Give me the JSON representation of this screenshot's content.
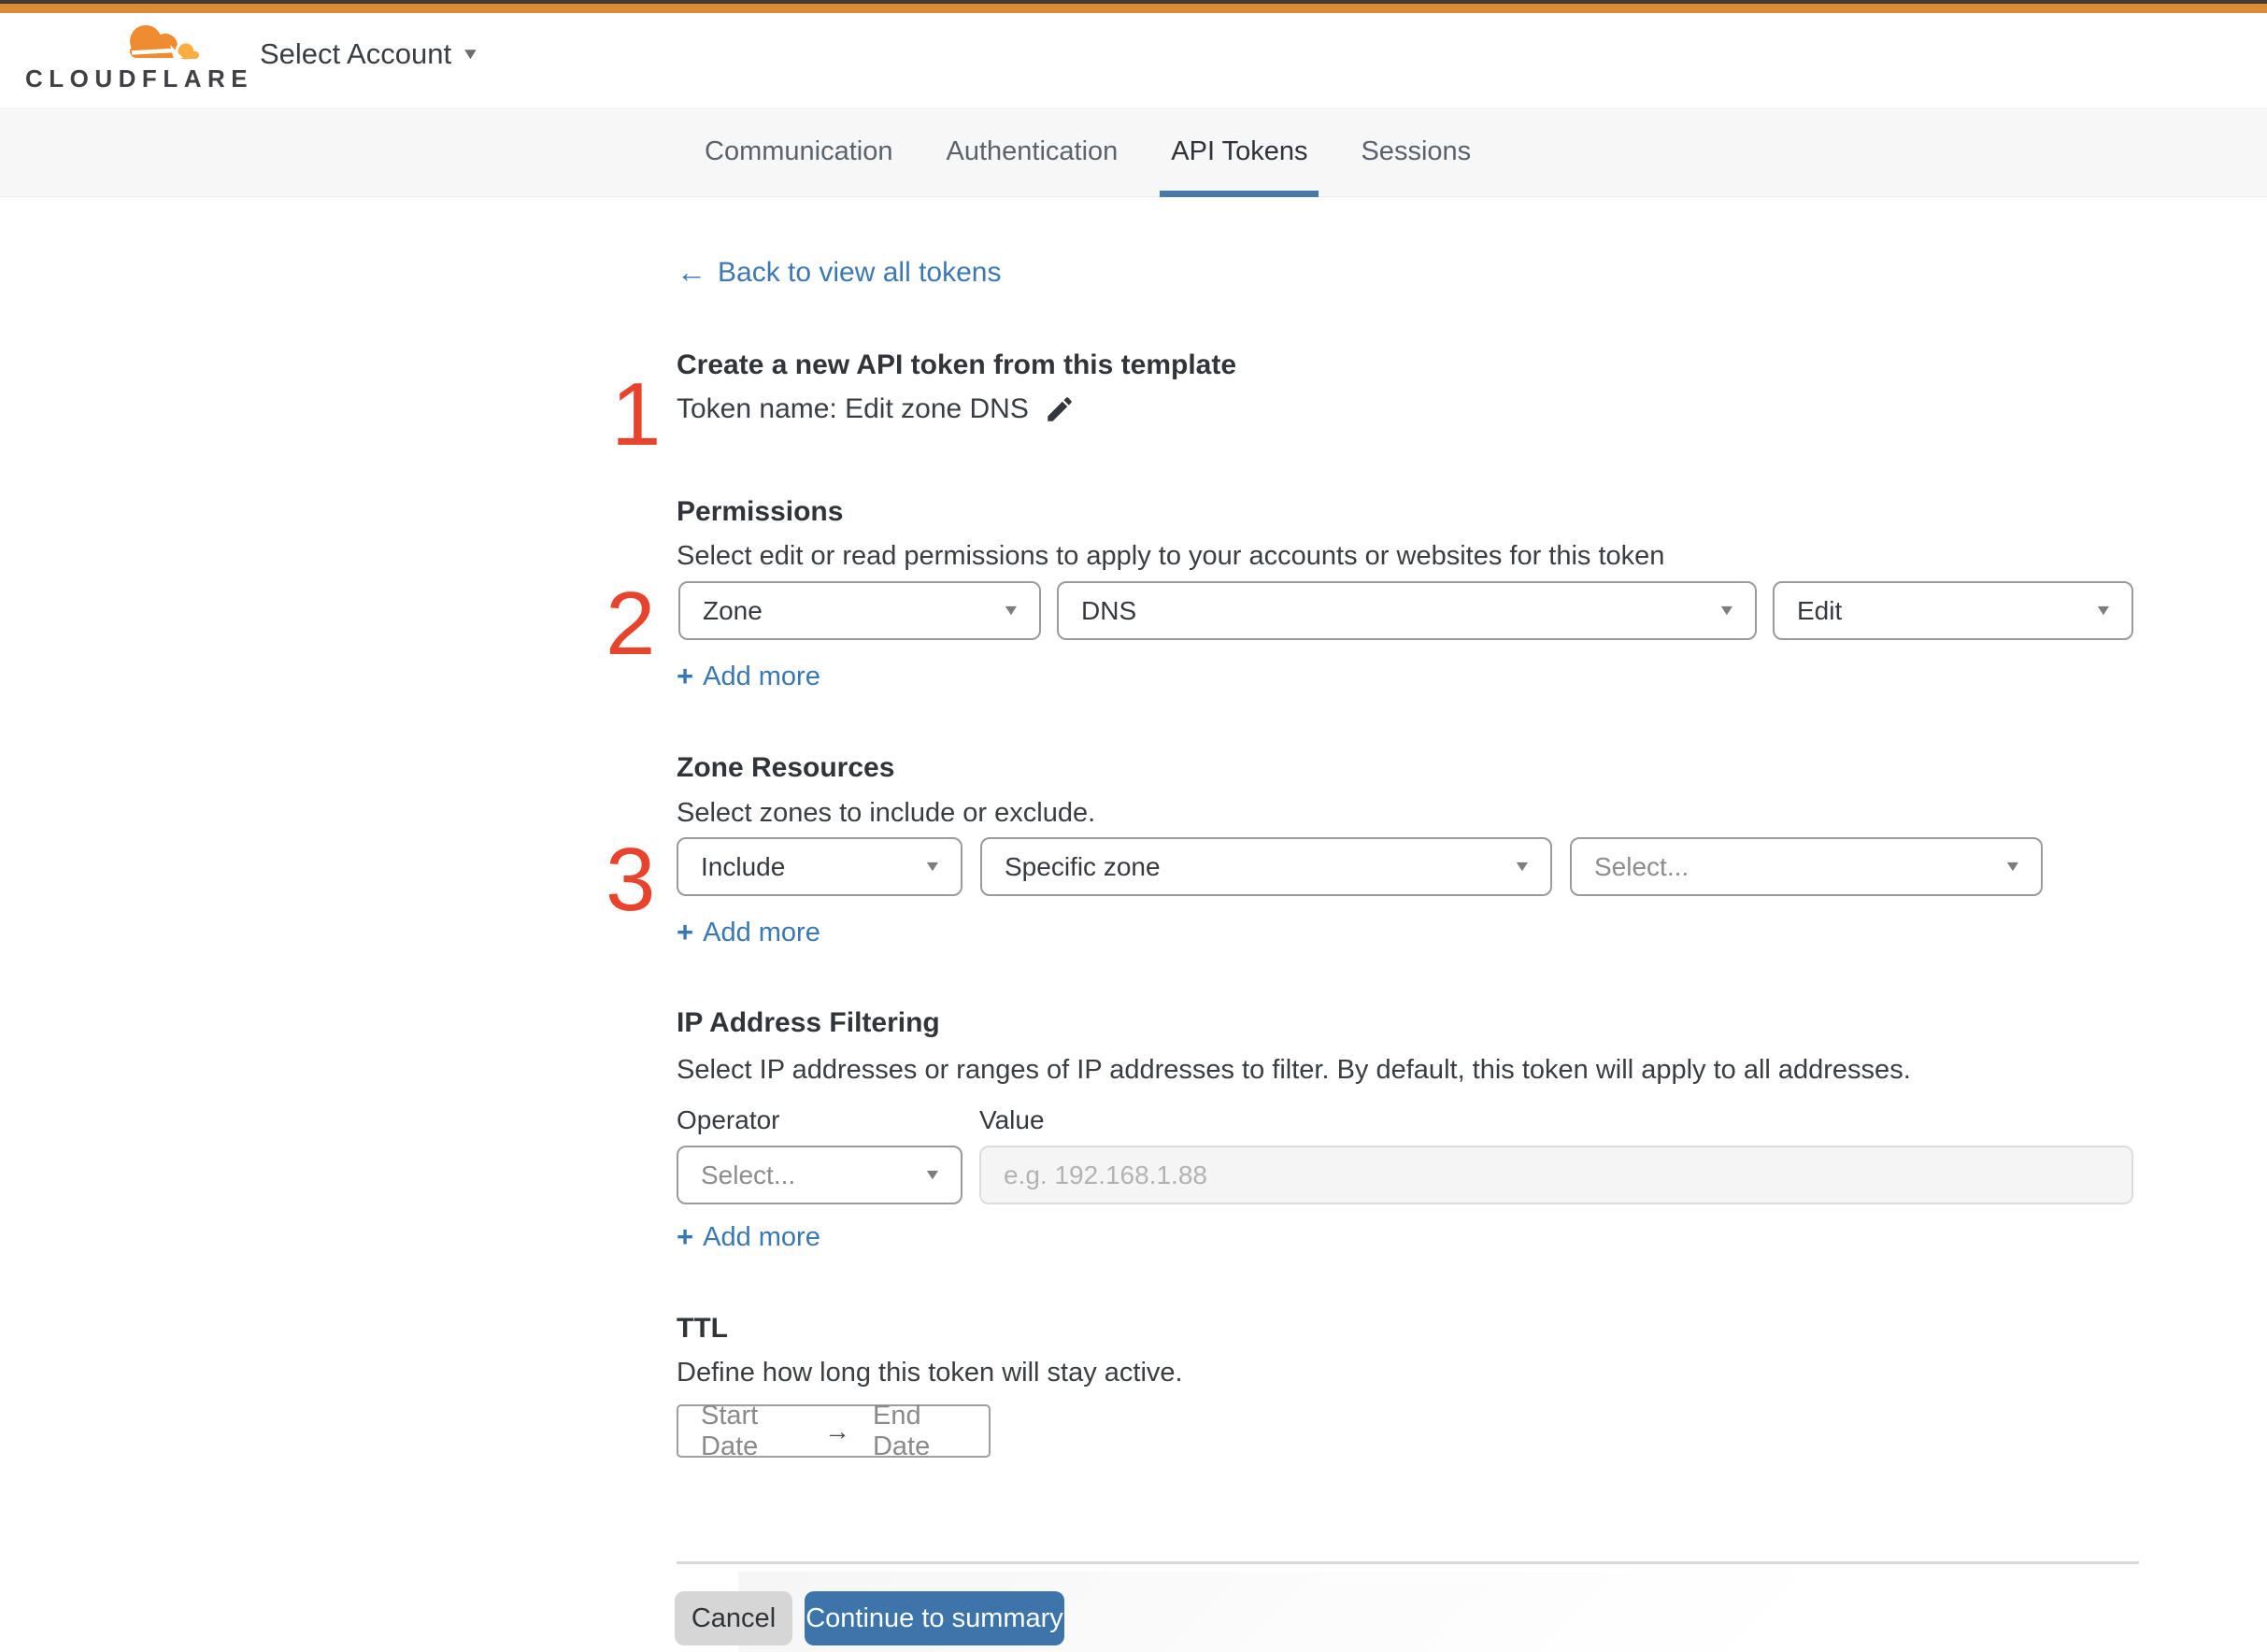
{
  "header": {
    "brand": "CLOUDFLARE",
    "account_selector": {
      "label": "Select Account",
      "caret": "▼"
    }
  },
  "tabs": [
    {
      "label": "Communication",
      "active": false
    },
    {
      "label": "Authentication",
      "active": false
    },
    {
      "label": "API Tokens",
      "active": true
    },
    {
      "label": "Sessions",
      "active": false
    }
  ],
  "back_link": {
    "arrow": "←",
    "label": "Back to view all tokens"
  },
  "steps": {
    "one": "1",
    "two": "2",
    "three": "3"
  },
  "create": {
    "title": "Create a new API token from this template",
    "token_name_label": "Token name: Edit zone DNS"
  },
  "permissions": {
    "title": "Permissions",
    "description": "Select edit or read permissions to apply to your accounts or websites for this token",
    "selects": [
      {
        "value": "Zone"
      },
      {
        "value": "DNS"
      },
      {
        "value": "Edit"
      }
    ]
  },
  "zone_resources": {
    "title": "Zone Resources",
    "description": "Select zones to include or exclude.",
    "selects": [
      {
        "value": "Include"
      },
      {
        "value": "Specific zone"
      },
      {
        "value": "Select..."
      }
    ]
  },
  "ip_filtering": {
    "title": "IP Address Filtering",
    "description": "Select IP addresses or ranges of IP addresses to filter. By default, this token will apply to all addresses.",
    "operator_label": "Operator",
    "value_label": "Value",
    "operator_select": "Select...",
    "value_placeholder": "e.g. 192.168.1.88"
  },
  "ttl": {
    "title": "TTL",
    "description": "Define how long this token will stay active.",
    "start": "Start Date",
    "arrow": "→",
    "end": "End Date"
  },
  "labels": {
    "plus": "+",
    "add_more": "Add more",
    "caret": "▼"
  },
  "footer": {
    "cancel": "Cancel",
    "continue": "Continue to summary"
  },
  "colors": {
    "top_bar_orange": "#dc8b36",
    "brand_cloud_orange": "#ef8b31",
    "brand_cloud_light": "#fbad41",
    "step_number_red": "#e8432c",
    "link_blue": "#3d78b0",
    "tab_underline_blue": "#4a79a8",
    "continue_button_blue": "#3d75aa",
    "cancel_button_gray": "#d6d6d6",
    "tabbar_background": "#f7f7f8"
  }
}
